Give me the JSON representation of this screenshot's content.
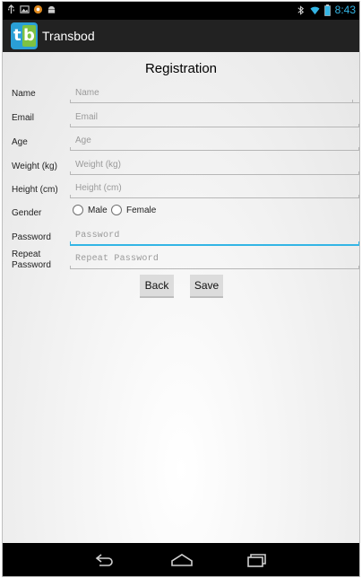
{
  "status_bar": {
    "time": "8:43",
    "icons_left": [
      "usb-icon",
      "image-icon",
      "app-notification-icon",
      "android-icon"
    ],
    "icons_right": [
      "bluetooth-icon",
      "wifi-icon",
      "battery-icon"
    ]
  },
  "app": {
    "title": "Transbod",
    "logo_text_t": "t",
    "logo_text_b": "b"
  },
  "form": {
    "title": "Registration",
    "fields": {
      "name": {
        "label": "Name",
        "placeholder": "Name"
      },
      "email": {
        "label": "Email",
        "placeholder": "Email"
      },
      "age": {
        "label": "Age",
        "placeholder": "Age"
      },
      "weight": {
        "label": "Weight (kg)",
        "placeholder": "Weight (kg)"
      },
      "height": {
        "label": "Height (cm)",
        "placeholder": "Height (cm)"
      },
      "password": {
        "label": "Password",
        "placeholder": "Password"
      },
      "repeat_password": {
        "label": "Repeat Password",
        "label_line1": "Repeat",
        "label_line2": "Password",
        "placeholder": "Repeat Password"
      }
    },
    "gender": {
      "label": "Gender",
      "options": [
        "Male",
        "Female"
      ]
    },
    "buttons": {
      "back": "Back",
      "save": "Save"
    }
  },
  "nav_bar": {
    "icons": [
      "back-icon",
      "home-icon",
      "recent-apps-icon"
    ]
  },
  "colors": {
    "accent": "#33b5e5",
    "action_bar": "#222222",
    "logo_blue": "#2a9fd6",
    "logo_green": "#7ec242"
  }
}
